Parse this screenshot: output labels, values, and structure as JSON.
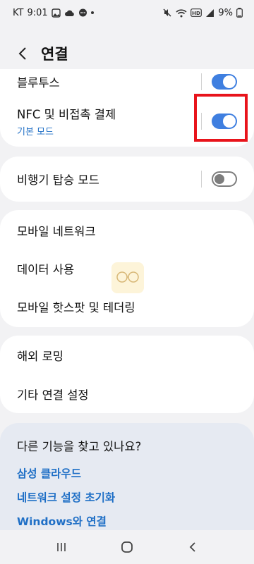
{
  "status_bar": {
    "carrier": "KT",
    "time": "9:01",
    "battery_percent": "9%",
    "icons_left": [
      "gallery-icon",
      "cloud-icon",
      "chat-icon"
    ],
    "icons_right": [
      "mute-icon",
      "wifi-icon",
      "hd-icon",
      "signal-icon",
      "battery-icon"
    ]
  },
  "header": {
    "title": "연결"
  },
  "settings": {
    "bluetooth": {
      "label": "블루투스",
      "enabled": true
    },
    "nfc": {
      "label": "NFC 및 비접촉 결제",
      "sublabel": "기본 모드",
      "enabled": true
    },
    "airplane": {
      "label": "비행기 탑승 모드",
      "enabled": false
    },
    "network_items": [
      "모바일 네트워크",
      "데이터 사용",
      "모바일 핫스팟 및 테더링"
    ],
    "more_items": [
      "해외 로밍",
      "기타 연결 설정"
    ]
  },
  "suggestions": {
    "title": "다른 기능을 찾고 있나요?",
    "links": [
      "삼성 클라우드",
      "네트워크 설정 초기화",
      "Windows와 연결"
    ]
  },
  "colors": {
    "accent": "#3f7fe0",
    "link": "#1f6fc6",
    "highlight": "#e8141b",
    "background": "#f2f2f4",
    "card": "#ffffff",
    "suggest_card": "#e6eaf2"
  }
}
